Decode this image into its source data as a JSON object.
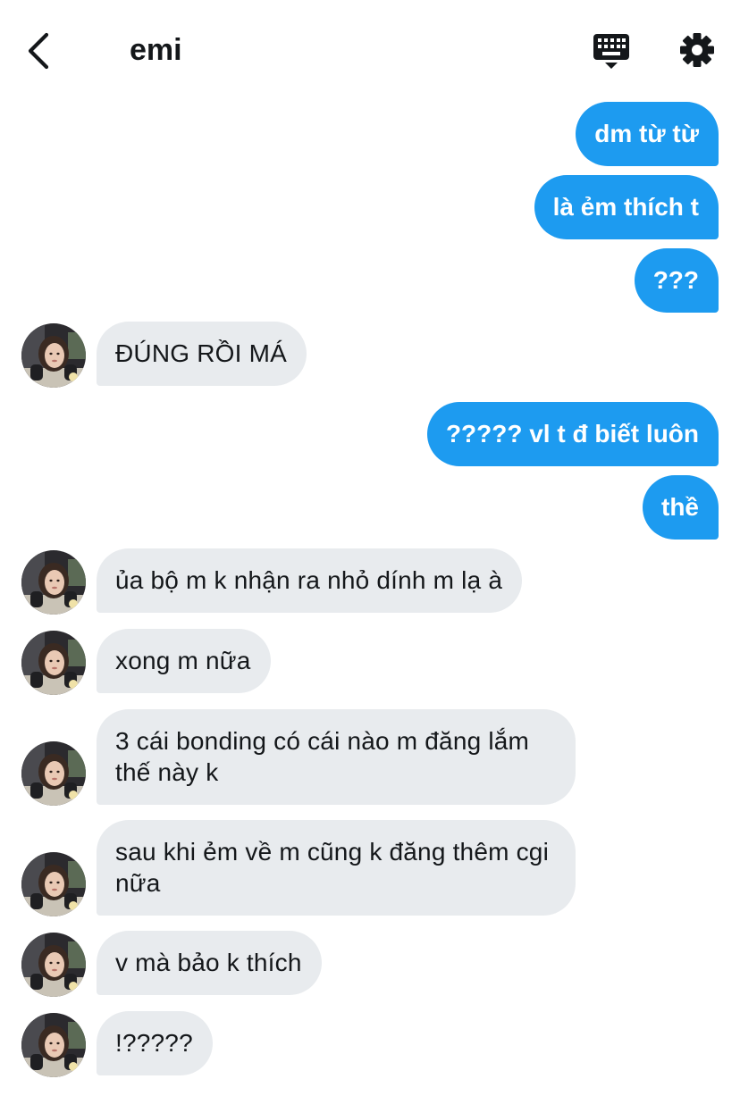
{
  "header": {
    "title": "emi",
    "back_icon": "chevron-left-icon",
    "keyboard_icon": "keyboard-icon",
    "settings_icon": "gear-icon"
  },
  "colors": {
    "outgoing_bubble": "#1d9bf0",
    "incoming_bubble": "#e8ebee",
    "text": "#14171a"
  },
  "messages": [
    {
      "dir": "out",
      "text": "dm từ từ"
    },
    {
      "dir": "out",
      "text": "là ẻm thích t"
    },
    {
      "dir": "out",
      "text": "???"
    },
    {
      "dir": "in",
      "text": "ĐÚNG RỒI MÁ"
    },
    {
      "dir": "out",
      "text": "????? vl t đ biết luôn"
    },
    {
      "dir": "out",
      "text": "thề"
    },
    {
      "dir": "in",
      "text": "ủa bộ m k nhận ra nhỏ dính m lạ à"
    },
    {
      "dir": "in",
      "text": "xong m nữa"
    },
    {
      "dir": "in",
      "text": "3 cái bonding có cái nào m đăng lắm thế này k"
    },
    {
      "dir": "in",
      "text": "sau khi ẻm về m cũng k đăng thêm cgi nữa"
    },
    {
      "dir": "in",
      "text": "v mà bảo k thích"
    },
    {
      "dir": "in",
      "text": "!?????"
    }
  ]
}
